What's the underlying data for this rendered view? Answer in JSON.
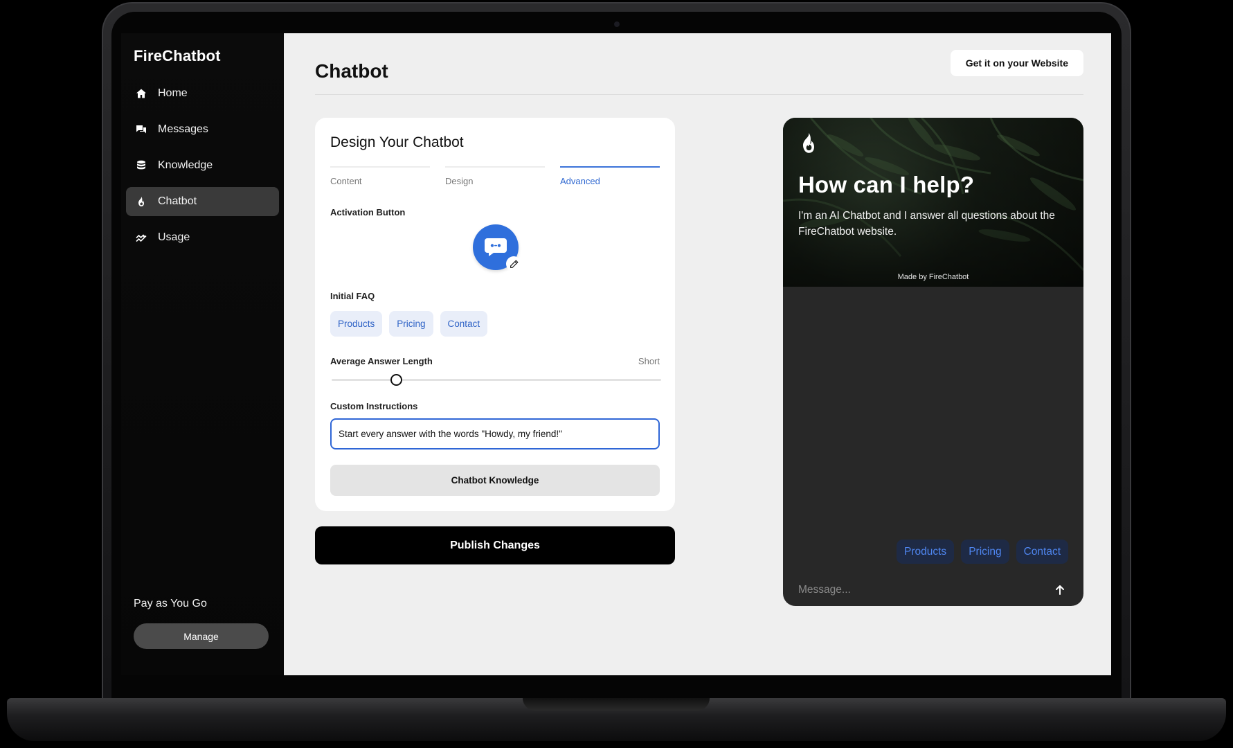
{
  "sidebar": {
    "brand": "FireChatbot",
    "items": [
      {
        "label": "Home",
        "icon": "home-icon"
      },
      {
        "label": "Messages",
        "icon": "messages-icon"
      },
      {
        "label": "Knowledge",
        "icon": "database-icon"
      },
      {
        "label": "Chatbot",
        "icon": "flame-icon",
        "active": true
      },
      {
        "label": "Usage",
        "icon": "chart-icon"
      }
    ],
    "plan_label": "Pay as You Go",
    "manage_label": "Manage"
  },
  "header": {
    "title": "Chatbot",
    "cta_label": "Get it on your Website"
  },
  "design_card": {
    "title": "Design Your Chatbot",
    "tabs": [
      {
        "label": "Content",
        "active": false
      },
      {
        "label": "Design",
        "active": false
      },
      {
        "label": "Advanced",
        "active": true
      }
    ],
    "activation_label": "Activation Button",
    "faq_label": "Initial FAQ",
    "faq_chips": [
      "Products",
      "Pricing",
      "Contact"
    ],
    "answer_length_label": "Average Answer Length",
    "answer_length_value": "Short",
    "answer_length_fraction": 0.2,
    "custom_instructions_label": "Custom Instructions",
    "custom_instructions_value": "Start every answer with the words \"Howdy, my friend!\"",
    "knowledge_button_label": "Chatbot Knowledge"
  },
  "publish_label": "Publish Changes",
  "chat_preview": {
    "title": "How can I help?",
    "subtitle": "I'm an AI Chatbot and I answer all questions about the FireChatbot website.",
    "made_by": "Made by FireChatbot",
    "chips": [
      "Products",
      "Pricing",
      "Contact"
    ],
    "input_placeholder": "Message..."
  },
  "colors": {
    "accent": "#2f6fdc",
    "sidebar_bg": "#0b0b0b",
    "active_nav": "#3a3a3a",
    "page_bg": "#efefef",
    "chat_bg": "#282828"
  }
}
